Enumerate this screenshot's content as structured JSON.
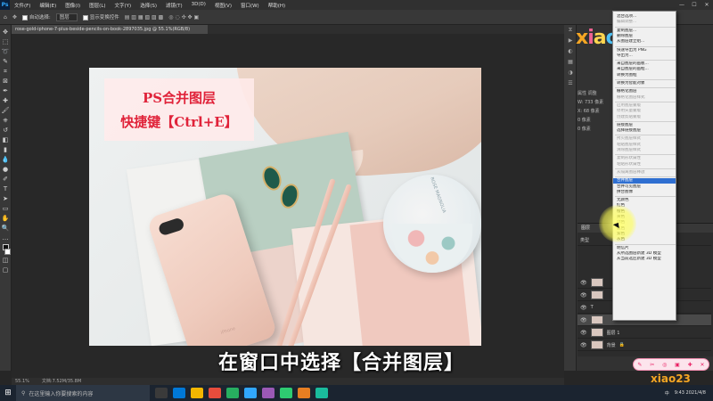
{
  "menubar": {
    "app_logo": "Ps",
    "items": [
      "文件(F)",
      "编辑(E)",
      "图像(I)",
      "图层(L)",
      "文字(Y)",
      "选择(S)",
      "滤镜(T)",
      "3D(D)",
      "视图(V)",
      "窗口(W)",
      "帮助(H)"
    ]
  },
  "optbar": {
    "auto_select_label": "自动选择:",
    "auto_select_value": "图层",
    "show_transform_label": "显示变换控件"
  },
  "document": {
    "tab_title": "rose-gold-iphone-7-plus-beside-pencils-on-book-2897035.jpg @ 55.1%(RGB/8)"
  },
  "overlay": {
    "title_line1": "PS合并图层",
    "title_line2": "快捷键【Ctrl+E】",
    "subtitle": "在窗口中选择【合并图层】"
  },
  "photo": {
    "phone_text": "iPhone",
    "tin_text": "ROSE MAGNOLIA"
  },
  "properties": {
    "tab_label": "属性",
    "tab2": "调整",
    "width_label": "W:",
    "width_value": "733 像素",
    "x_label": "X:",
    "x_value": "68 像素",
    "height_value": "0 像素",
    "height_value2": "0 像素"
  },
  "layers": {
    "header": "图层",
    "search_kind": "类型",
    "bottom_layer": "背景",
    "layer1": "图层 1",
    "text_layer": "T"
  },
  "context_menu": {
    "items": [
      {
        "label": "混合选项...",
        "state": "normal"
      },
      {
        "label": "编辑调整...",
        "state": "disabled"
      },
      {
        "sep": true
      },
      {
        "label": "复制图层...",
        "state": "normal"
      },
      {
        "label": "删除图层",
        "state": "normal"
      },
      {
        "label": "从图层建立组...",
        "state": "normal"
      },
      {
        "sep": true
      },
      {
        "label": "快速导出为 PNG",
        "state": "normal"
      },
      {
        "label": "导出为...",
        "state": "normal"
      },
      {
        "sep": true
      },
      {
        "label": "来自图层的画板...",
        "state": "normal"
      },
      {
        "label": "来自图层的画框...",
        "state": "normal"
      },
      {
        "label": "转换为图框",
        "state": "normal"
      },
      {
        "sep": true
      },
      {
        "label": "转换为智能对象",
        "state": "normal"
      },
      {
        "sep": true
      },
      {
        "label": "栅格化图层",
        "state": "normal"
      },
      {
        "label": "栅格化图层样式",
        "state": "disabled"
      },
      {
        "sep": true
      },
      {
        "label": "启用图层蒙版",
        "state": "disabled"
      },
      {
        "label": "停用矢量蒙版",
        "state": "disabled"
      },
      {
        "label": "创建剪贴蒙版",
        "state": "disabled"
      },
      {
        "sep": true
      },
      {
        "label": "链接图层",
        "state": "normal"
      },
      {
        "label": "选择链接图层",
        "state": "normal"
      },
      {
        "sep": true
      },
      {
        "label": "拷贝图层样式",
        "state": "disabled"
      },
      {
        "label": "粘贴图层样式",
        "state": "disabled"
      },
      {
        "label": "清除图层样式",
        "state": "disabled"
      },
      {
        "sep": true
      },
      {
        "label": "复制形状属性",
        "state": "disabled"
      },
      {
        "label": "粘贴形状属性",
        "state": "disabled"
      },
      {
        "sep": true
      },
      {
        "label": "从隔离图层释放",
        "state": "disabled"
      },
      {
        "sep": true
      },
      {
        "label": "合并图层",
        "state": "highlight"
      },
      {
        "label": "合并可见图层",
        "state": "normal"
      },
      {
        "label": "拼合图像",
        "state": "normal"
      },
      {
        "sep": true
      },
      {
        "label": "无颜色",
        "state": "normal"
      },
      {
        "label": "红色",
        "state": "normal"
      },
      {
        "label": "橙色",
        "state": "normal"
      },
      {
        "label": "黄色",
        "state": "normal"
      },
      {
        "label": "绿色",
        "state": "normal"
      },
      {
        "label": "蓝色",
        "state": "normal"
      },
      {
        "label": "紫色",
        "state": "normal"
      },
      {
        "label": "灰色",
        "state": "normal"
      },
      {
        "sep": true
      },
      {
        "label": "明信片",
        "state": "normal"
      },
      {
        "label": "从所选图层新建 3D 模型",
        "state": "normal"
      },
      {
        "label": "从当前选区新建 3D 模型",
        "state": "normal"
      }
    ]
  },
  "status": {
    "zoom": "55.1%",
    "doc_size": "文档:7.52M/35.8M"
  },
  "taskbar": {
    "search_placeholder": "在这里输入你要搜索的内容",
    "time": "9:43",
    "date": "2021/4/8",
    "lang": "中"
  },
  "logo": {
    "letters": [
      "x",
      "i",
      "a",
      "o",
      "2",
      "3",
      "+"
    ],
    "small": "xiao23"
  },
  "colors": {
    "ps_blue": "#31a8ff",
    "menu_highlight": "#2f6fd1",
    "title_red": "#e0233a"
  }
}
